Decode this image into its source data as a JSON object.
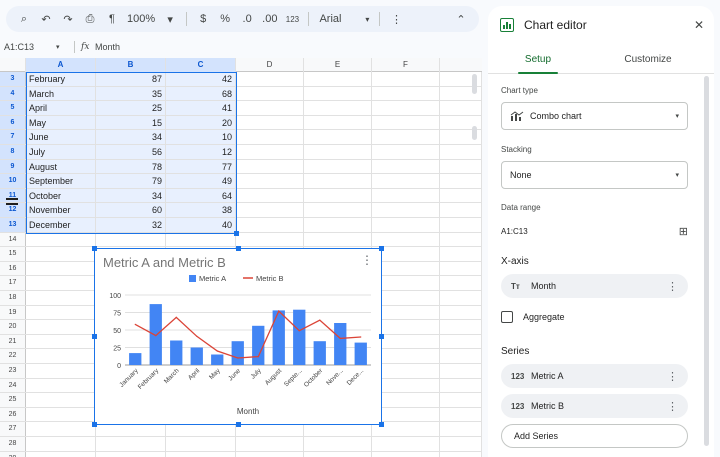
{
  "toolbar": {
    "search_icon": "⌕",
    "undo_icon": "↶",
    "redo_icon": "↷",
    "print_icon": "⎙",
    "paint_icon": "¶",
    "zoom": "100%",
    "zoom_caret": "▾",
    "currency": "$",
    "percent": "%",
    "dec_decrease": ".0",
    "dec_increase": ".00",
    "number_format": "123",
    "font": "Arial",
    "font_caret": "▾",
    "more": "⋮",
    "collapse": "⌃"
  },
  "formula_bar": {
    "range": "A1:C13",
    "caret": "▾",
    "fx": "fx",
    "content": "Month"
  },
  "grid": {
    "columns": [
      "A",
      "B",
      "C",
      "D",
      "E",
      "F"
    ],
    "rows": [
      {
        "num": "3",
        "month": "February",
        "a": "87",
        "b": "42"
      },
      {
        "num": "4",
        "month": "March",
        "a": "35",
        "b": "68"
      },
      {
        "num": "5",
        "month": "April",
        "a": "25",
        "b": "41"
      },
      {
        "num": "6",
        "month": "May",
        "a": "15",
        "b": "20"
      },
      {
        "num": "7",
        "month": "June",
        "a": "34",
        "b": "10"
      },
      {
        "num": "8",
        "month": "July",
        "a": "56",
        "b": "12"
      },
      {
        "num": "9",
        "month": "August",
        "a": "78",
        "b": "77"
      },
      {
        "num": "10",
        "month": "September",
        "a": "79",
        "b": "49"
      },
      {
        "num": "11",
        "month": "October",
        "a": "34",
        "b": "64"
      },
      {
        "num": "12",
        "month": "November",
        "a": "60",
        "b": "38"
      },
      {
        "num": "13",
        "month": "December",
        "a": "32",
        "b": "40"
      }
    ],
    "empty_rows": [
      "14",
      "15",
      "16",
      "17",
      "18",
      "19",
      "20",
      "21",
      "22",
      "23",
      "24",
      "25",
      "26",
      "27",
      "28",
      "29"
    ]
  },
  "chart_data": {
    "type": "bar",
    "title": "Metric A and Metric B",
    "xlabel": "Month",
    "ylabel": "",
    "ylim": [
      0,
      100
    ],
    "yticks": [
      "0",
      "25",
      "50",
      "75",
      "100"
    ],
    "categories": [
      "January",
      "February",
      "March",
      "April",
      "May",
      "June",
      "July",
      "August",
      "Septe...",
      "October",
      "Nove...",
      "Dece..."
    ],
    "series": [
      {
        "name": "Metric A",
        "type": "bar",
        "color": "#4285f4",
        "values": [
          17,
          87,
          35,
          25,
          15,
          34,
          56,
          78,
          79,
          34,
          60,
          32
        ]
      },
      {
        "name": "Metric B",
        "type": "line",
        "color": "#db4437",
        "values": [
          58,
          42,
          68,
          41,
          20,
          10,
          12,
          77,
          49,
          64,
          38,
          40
        ]
      }
    ],
    "legend": "top",
    "menu_icon": "⋮"
  },
  "panel": {
    "title": "Chart editor",
    "close_icon": "✕",
    "tabs": [
      "Setup",
      "Customize"
    ],
    "chart_type_label": "Chart type",
    "chart_type_value": "Combo chart",
    "stacking_label": "Stacking",
    "stacking_value": "None",
    "data_range_label": "Data range",
    "data_range_value": "A1:C13",
    "grid_icon": "⊞",
    "xaxis_heading": "X-axis",
    "xaxis_icon": "Tт",
    "xaxis_value": "Month",
    "aggregate_label": "Aggregate",
    "series_heading": "Series",
    "series": [
      {
        "icon": "123",
        "name": "Metric A"
      },
      {
        "icon": "123",
        "name": "Metric B"
      }
    ],
    "add_series": "Add Series",
    "dots": "⋮",
    "caret": "▾"
  }
}
